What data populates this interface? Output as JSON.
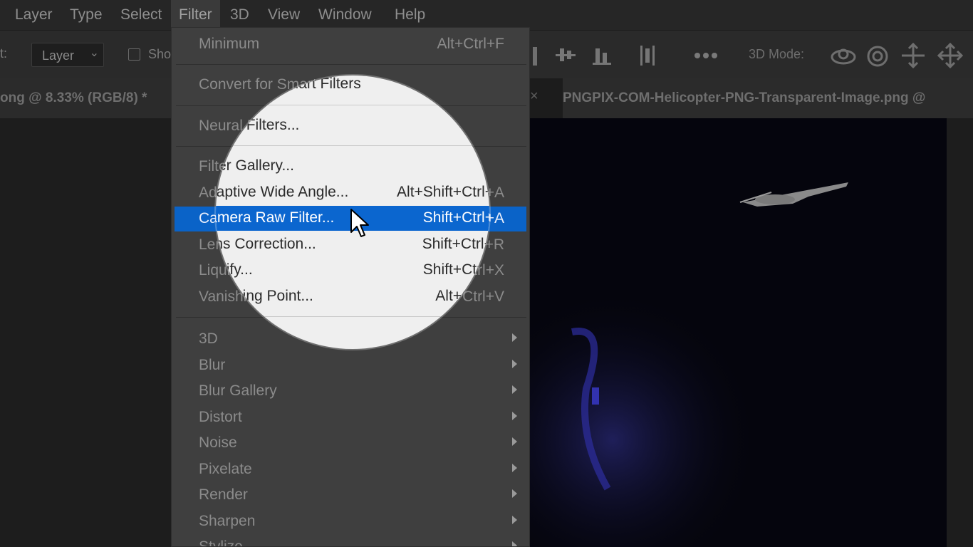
{
  "menubar": {
    "items": [
      {
        "label": "Layer"
      },
      {
        "label": "Type"
      },
      {
        "label": "Select"
      },
      {
        "label": "Filter"
      },
      {
        "label": "3D"
      },
      {
        "label": "View"
      },
      {
        "label": "Window"
      },
      {
        "label": "Help"
      }
    ],
    "active": "Filter"
  },
  "options_bar": {
    "label_fragment": "t:",
    "layer_select_value": "Layer",
    "show_label_fragment": "Sho",
    "mode_3d_label": "3D Mode:"
  },
  "tabs": [
    {
      "label": "ong @ 8.33% (RGB/8) *"
    },
    {
      "label": "PNGPIX-COM-Helicopter-PNG-Transparent-Image.png @"
    }
  ],
  "filter_menu": {
    "items": [
      {
        "label": "Minimum",
        "shortcut": "Alt+Ctrl+F"
      },
      {
        "label": "Convert for Smart Filters",
        "shortcut": ""
      },
      {
        "label": "Neural Filters...",
        "shortcut": ""
      },
      {
        "label": "Filter Gallery...",
        "shortcut": ""
      },
      {
        "label": "Adaptive Wide Angle...",
        "shortcut": "Alt+Shift+Ctrl+A"
      },
      {
        "label": "Camera Raw Filter...",
        "shortcut": "Shift+Ctrl+A",
        "highlighted": true
      },
      {
        "label": "Lens Correction...",
        "shortcut": "Shift+Ctrl+R"
      },
      {
        "label": "Liquify...",
        "shortcut": "Shift+Ctrl+X"
      },
      {
        "label": "Vanishing Point...",
        "shortcut": "Alt+Ctrl+V"
      },
      {
        "label": "3D",
        "submenu": true
      },
      {
        "label": "Blur",
        "submenu": true
      },
      {
        "label": "Blur Gallery",
        "submenu": true
      },
      {
        "label": "Distort",
        "submenu": true
      },
      {
        "label": "Noise",
        "submenu": true
      },
      {
        "label": "Pixelate",
        "submenu": true
      },
      {
        "label": "Render",
        "submenu": true
      },
      {
        "label": "Sharpen",
        "submenu": true
      },
      {
        "label": "Stylize",
        "submenu": true
      }
    ]
  },
  "colors": {
    "menu_bg": "#3f3f3f",
    "highlight": "#0a63c8",
    "spotlight": "#efefef"
  },
  "icons": [
    "align-icon",
    "distribute-icon",
    "more-icon",
    "orbit-3d-icon",
    "roll-3d-icon",
    "pan-3d-icon",
    "slide-3d-icon",
    "pointer-cursor-icon"
  ]
}
